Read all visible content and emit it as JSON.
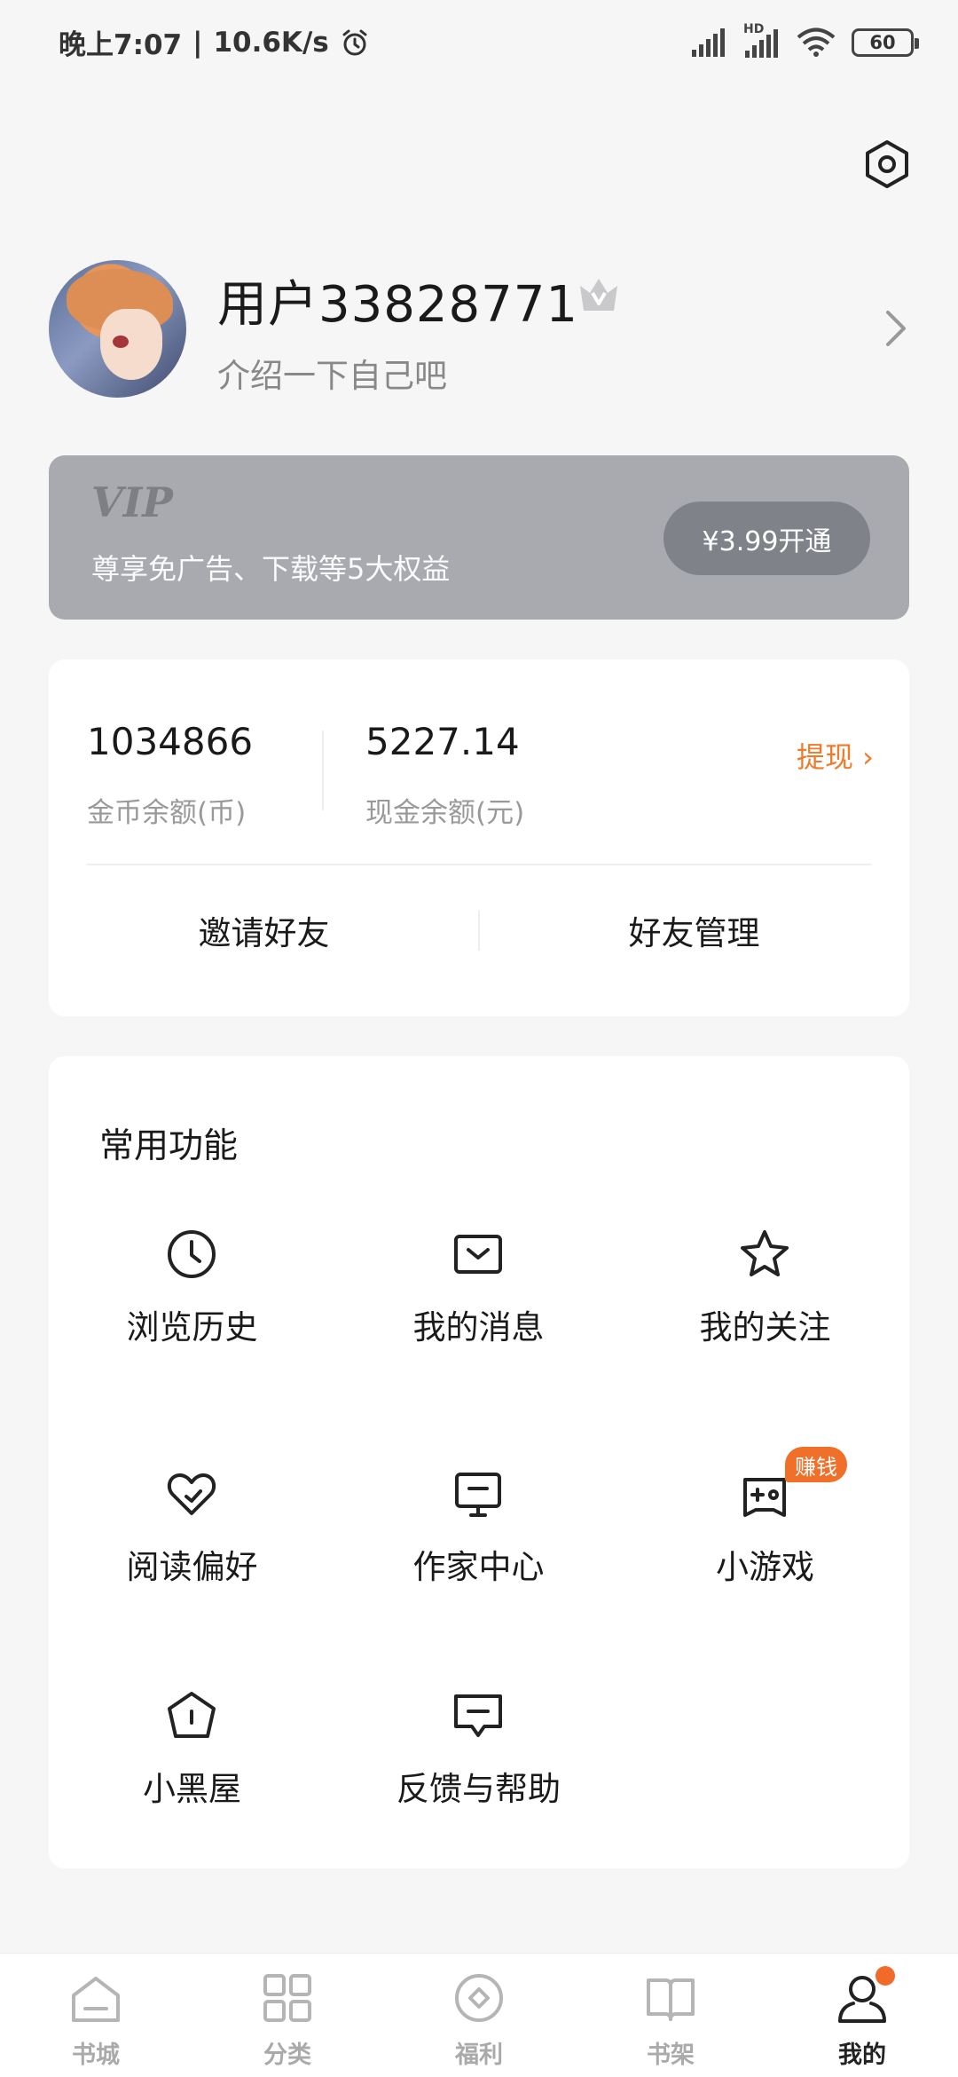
{
  "status_bar": {
    "time": "晚上7:07",
    "network_speed": "10.6K/s",
    "hd_label": "HD",
    "battery": "60"
  },
  "profile": {
    "username": "用户33828771",
    "bio": "介绍一下自己吧"
  },
  "vip": {
    "title": "VIP",
    "description": "尊享免广告、下载等5大权益",
    "button": "¥3.99开通"
  },
  "balance": {
    "coins_value": "1034866",
    "coins_label": "金币余额(币)",
    "cash_value": "5227.14",
    "cash_label": "现金余额(元)",
    "withdraw": "提现 ›",
    "invite": "邀请好友",
    "friends": "好友管理"
  },
  "functions": {
    "title": "常用功能",
    "items": [
      {
        "label": "浏览历史",
        "icon": "clock-icon"
      },
      {
        "label": "我的消息",
        "icon": "message-icon"
      },
      {
        "label": "我的关注",
        "icon": "star-icon"
      },
      {
        "label": "阅读偏好",
        "icon": "heart-check-icon"
      },
      {
        "label": "作家中心",
        "icon": "monitor-icon"
      },
      {
        "label": "小游戏",
        "icon": "gamepad-icon",
        "badge": "赚钱"
      },
      {
        "label": "小黑屋",
        "icon": "pentagon-alert-icon"
      },
      {
        "label": "反馈与帮助",
        "icon": "chat-icon"
      }
    ]
  },
  "nav": {
    "items": [
      {
        "label": "书城",
        "icon": "home-icon"
      },
      {
        "label": "分类",
        "icon": "grid-icon"
      },
      {
        "label": "福利",
        "icon": "coin-icon"
      },
      {
        "label": "书架",
        "icon": "book-icon"
      },
      {
        "label": "我的",
        "icon": "user-icon"
      }
    ],
    "active": "我的"
  },
  "colors": {
    "accent": "#f07a2a",
    "vip_bg": "#a8aab0",
    "background": "#f6f6f6"
  }
}
